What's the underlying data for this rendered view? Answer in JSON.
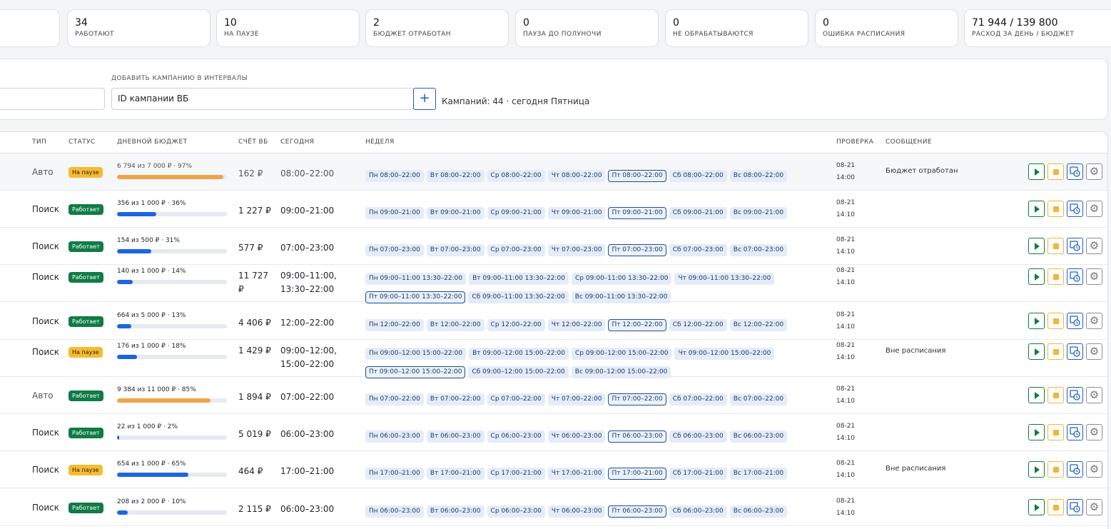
{
  "stats": [
    {
      "value": "",
      "label": ""
    },
    {
      "value": "34",
      "label": "Работают"
    },
    {
      "value": "10",
      "label": "На паузе"
    },
    {
      "value": "2",
      "label": "Бюджет отработан"
    },
    {
      "value": "0",
      "label": "Пауза до полуночи"
    },
    {
      "value": "0",
      "label": "Не обрабатываются"
    },
    {
      "value": "0",
      "label": "Ошибка расписания"
    },
    {
      "value": "71 944 / 139 800",
      "label": "Расход за день / бюджет"
    }
  ],
  "add_panel": {
    "label": "ДОБАВИТЬ КАМПАНИЮ В ИНТЕРВАЛЫ",
    "input_value": "ID кампании ВБ",
    "plus": "+",
    "info": "Кампаний: 44 · сегодня Пятница"
  },
  "table": {
    "headers": [
      "ТИП",
      "СТАТУС",
      "ДНЕВНОЙ БЮДЖЕТ",
      "СЧЁТ ВБ",
      "СЕГОДНЯ",
      "НЕДЕЛЯ",
      "ПРОВЕРКА",
      "СООБЩЕНИЕ"
    ],
    "rows": [
      {
        "type": "Авто",
        "status": "На паузе",
        "status_kind": "pause",
        "budget_text": "6 794 из 7 000 ₽ · 97%",
        "budget_pct": 97,
        "bar_color": "#f0a44a",
        "account": "162 ₽",
        "today": "08:00–22:00",
        "check_date": "08-21",
        "check_time": "14:00",
        "message": "Бюджет отработан",
        "week": [
          "Пн 08:00–22:00",
          "Вт 08:00–22:00",
          "Ср 08:00–22:00",
          "Чт 08:00–22:00",
          "Пт 08:00–22:00",
          "Сб 08:00–22:00",
          "Вс 08:00–22:00"
        ]
      },
      {
        "type": "Поиск",
        "status": "Работает",
        "status_kind": "run",
        "budget_text": "356 из 1 000 ₽ · 36%",
        "budget_pct": 36,
        "bar_color": "#1a66e0",
        "account": "1 227 ₽",
        "today": "09:00–21:00",
        "check_date": "08-21",
        "check_time": "14:10",
        "message": "",
        "week": [
          "Пн 09:00–21:00",
          "Вт 09:00–21:00",
          "Ср 09:00–21:00",
          "Чт 09:00–21:00",
          "Пт 09:00–21:00",
          "Сб 09:00–21:00",
          "Вс 09:00–21:00"
        ]
      },
      {
        "type": "Поиск",
        "status": "Работает",
        "status_kind": "run",
        "budget_text": "154 из 500 ₽ · 31%",
        "budget_pct": 31,
        "bar_color": "#1a66e0",
        "account": "577 ₽",
        "today": "07:00–23:00",
        "check_date": "08-21",
        "check_time": "14:10",
        "message": "",
        "week": [
          "Пн 07:00–23:00",
          "Вт 07:00–23:00",
          "Ср 07:00–23:00",
          "Чт 07:00–23:00",
          "Пт 07:00–23:00",
          "Сб 07:00–23:00",
          "Вс 07:00–23:00"
        ]
      },
      {
        "type": "Поиск",
        "status": "Работает",
        "status_kind": "run",
        "budget_text": "140 из 1 000 ₽ · 14%",
        "budget_pct": 14,
        "bar_color": "#1a66e0",
        "account": "11 727 ₽",
        "today": "09:00–11:00, 13:30–22:00",
        "check_date": "08-21",
        "check_time": "14:10",
        "message": "",
        "week": [
          "Пн 09:00–11:00 13:30–22:00",
          "Вт 09:00–11:00 13:30–22:00",
          "Ср 09:00–11:00 13:30–22:00",
          "Чт 09:00–11:00 13:30–22:00",
          "Пт 09:00–11:00 13:30–22:00",
          "Сб 09:00–11:00 13:30–22:00",
          "Вс 09:00–11:00 13:30–22:00"
        ]
      },
      {
        "type": "Поиск",
        "status": "Работает",
        "status_kind": "run",
        "budget_text": "664 из 5 000 ₽ · 13%",
        "budget_pct": 13,
        "bar_color": "#1a66e0",
        "account": "4 406 ₽",
        "today": "12:00–22:00",
        "check_date": "08-21",
        "check_time": "14:10",
        "message": "",
        "week": [
          "Пн 12:00–22:00",
          "Вт 12:00–22:00",
          "Ср 12:00–22:00",
          "Чт 12:00–22:00",
          "Пт 12:00–22:00",
          "Сб 12:00–22:00",
          "Вс 12:00–22:00"
        ]
      },
      {
        "type": "Поиск",
        "status": "На паузе",
        "status_kind": "pause",
        "budget_text": "176 из 1 000 ₽ · 18%",
        "budget_pct": 18,
        "bar_color": "#1a66e0",
        "account": "1 429 ₽",
        "today": "09:00–12:00, 15:00–22:00",
        "check_date": "08-21",
        "check_time": "14:10",
        "message": "Вне расписания",
        "week": [
          "Пн 09:00–12:00 15:00–22:00",
          "Вт 09:00–12:00 15:00–22:00",
          "Ср 09:00–12:00 15:00–22:00",
          "Чт 09:00–12:00 15:00–22:00",
          "Пт 09:00–12:00 15:00–22:00",
          "Сб 09:00–12:00 15:00–22:00",
          "Вс 09:00–12:00 15:00–22:00"
        ]
      },
      {
        "type": "Авто",
        "status": "Работает",
        "status_kind": "run",
        "budget_text": "9 384 из 11 000 ₽ · 85%",
        "budget_pct": 85,
        "bar_color": "#f0a44a",
        "account": "1 894 ₽",
        "today": "07:00–22:00",
        "check_date": "08-21",
        "check_time": "14:10",
        "message": "",
        "week": [
          "Пн 07:00–22:00",
          "Вт 07:00–22:00",
          "Ср 07:00–22:00",
          "Чт 07:00–22:00",
          "Пт 07:00–22:00",
          "Сб 07:00–22:00",
          "Вс 07:00–22:00"
        ]
      },
      {
        "type": "Поиск",
        "status": "Работает",
        "status_kind": "run",
        "budget_text": "22 из 1 000 ₽ · 2%",
        "budget_pct": 2,
        "bar_color": "#1a66e0",
        "account": "5 019 ₽",
        "today": "06:00–23:00",
        "check_date": "08-21",
        "check_time": "14:10",
        "message": "",
        "week": [
          "Пн 06:00–23:00",
          "Вт 06:00–23:00",
          "Ср 06:00–23:00",
          "Чт 06:00–23:00",
          "Пт 06:00–23:00",
          "Сб 06:00–23:00",
          "Вс 06:00–23:00"
        ]
      },
      {
        "type": "Поиск",
        "status": "На паузе",
        "status_kind": "pause",
        "budget_text": "654 из 1 000 ₽ · 65%",
        "budget_pct": 65,
        "bar_color": "#1a66e0",
        "account": "464 ₽",
        "today": "17:00–21:00",
        "check_date": "08-21",
        "check_time": "14:10",
        "message": "Вне расписания",
        "week": [
          "Пн 17:00–21:00",
          "Вт 17:00–21:00",
          "Ср 17:00–21:00",
          "Чт 17:00–21:00",
          "Пт 17:00–21:00",
          "Сб 17:00–21:00",
          "Вс 17:00–21:00"
        ]
      },
      {
        "type": "Поиск",
        "status": "Работает",
        "status_kind": "run",
        "budget_text": "208 из 2 000 ₽ · 10%",
        "budget_pct": 10,
        "bar_color": "#1a66e0",
        "account": "2 115 ₽",
        "today": "06:00–23:00",
        "check_date": "08-21",
        "check_time": "14:10",
        "message": "",
        "week": [
          "Пн 06:00–23:00",
          "Вт 06:00–23:00",
          "Ср 06:00–23:00",
          "Чт 06:00–23:00",
          "Пт 06:00–23:00",
          "Сб 06:00–23:00",
          "Вс 06:00–23:00"
        ]
      }
    ],
    "today_index": 4
  },
  "icons": {
    "play": "play-icon",
    "stop": "stop-icon",
    "schedule": "schedule-icon",
    "settings": "gear-icon"
  }
}
